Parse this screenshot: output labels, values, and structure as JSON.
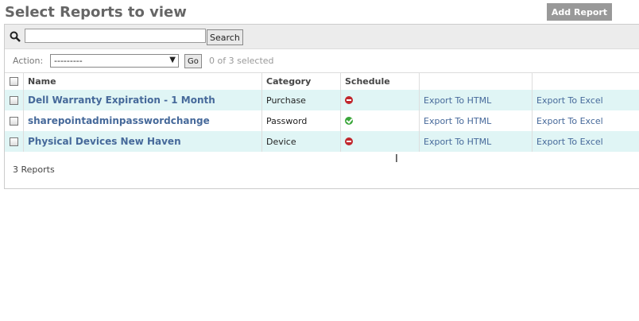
{
  "header": {
    "title": "Select Reports to view",
    "add_report_label": "Add Report"
  },
  "search": {
    "value": "",
    "placeholder": "",
    "button_label": "Search"
  },
  "actions": {
    "label": "Action:",
    "selected": "---------",
    "go_label": "Go",
    "selection_status": "0 of 3 selected"
  },
  "table": {
    "columns": [
      "Name",
      "Category",
      "Schedule",
      "",
      ""
    ],
    "rows": [
      {
        "name": "Dell Warranty Expiration - 1 Month",
        "category": "Purchase",
        "schedule_icon": "disabled-icon",
        "export_html": "Export To HTML",
        "export_excel": "Export To Excel"
      },
      {
        "name": "sharepointadminpasswordchange",
        "category": "Password",
        "schedule_icon": "enabled-icon",
        "export_html": "Export To HTML",
        "export_excel": "Export To Excel"
      },
      {
        "name": "Physical Devices New Haven",
        "category": "Device",
        "schedule_icon": "disabled-icon",
        "export_html": "Export To HTML",
        "export_excel": "Export To Excel"
      }
    ]
  },
  "footer": {
    "count_label": "3 Reports"
  },
  "colors": {
    "link": "#46699a",
    "row_alt": "#e0f5f5",
    "button_gray": "#999999",
    "status_red": "#c1272d",
    "status_green": "#3aa63a"
  }
}
